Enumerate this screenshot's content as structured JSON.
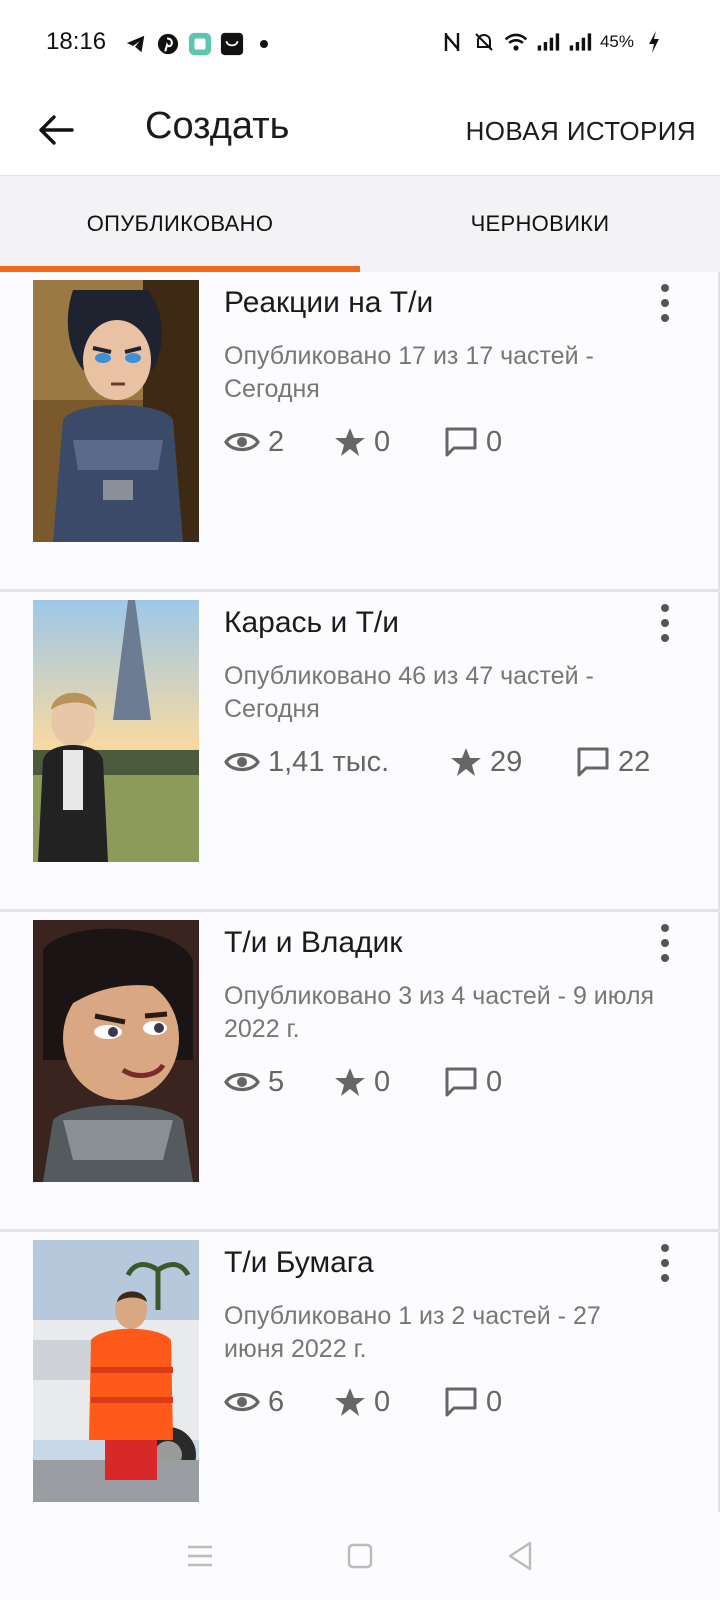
{
  "status_bar": {
    "time": "18:16",
    "battery": "45%",
    "left_icons": [
      "telegram-icon",
      "pinterest-icon",
      "app-icon",
      "shopping-icon",
      "dot-icon"
    ],
    "right_icons": [
      "nfc-icon",
      "mute-icon",
      "wifi-icon",
      "signal-icon",
      "signal-icon",
      "charging-icon"
    ]
  },
  "app_bar": {
    "title": "Создать",
    "action_label": "НОВАЯ ИСТОРИЯ"
  },
  "tabs": [
    {
      "label": "ОПУБЛИКОВАНО",
      "selected": true
    },
    {
      "label": "ЧЕРНОВИКИ",
      "selected": false
    }
  ],
  "accent_color": "#f06a1d",
  "stories": [
    {
      "title": "Реакции на Т/и",
      "meta": "Опубликовано 17 из 17 частей - Сегодня",
      "views": "2",
      "votes": "0",
      "comments": "0"
    },
    {
      "title": "Карась и Т/и",
      "meta": "Опубликовано 46 из 47 частей - Сегодня",
      "views": "1,41 тыс.",
      "votes": "29",
      "comments": "22"
    },
    {
      "title": "Т/и и Владик",
      "meta": "Опубликовано 3 из 4 частей - 9 июля 2022 г.",
      "views": "5",
      "votes": "0",
      "comments": "0"
    },
    {
      "title": "Т/и Бумага",
      "meta": "Опубликовано 1 из 2 частей - 27 июня 2022 г.",
      "views": "6",
      "votes": "0",
      "comments": "0"
    }
  ],
  "nav_bar": [
    "menu-icon",
    "home-square-icon",
    "back-triangle-icon"
  ]
}
